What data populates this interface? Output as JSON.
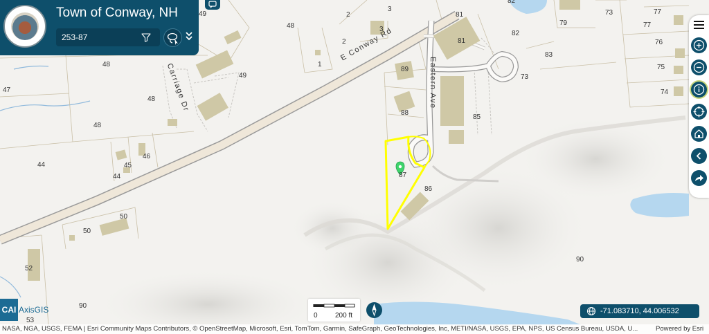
{
  "header": {
    "title": "Town of Conway, NH",
    "search": {
      "value": "253-87",
      "placeholder": ""
    },
    "logo_text": "TOWN OF CONWAY"
  },
  "toolbar": {
    "items": [
      "menu",
      "zoom-in",
      "zoom-out",
      "identify",
      "locate",
      "home",
      "collapse",
      "share"
    ]
  },
  "roads": {
    "e_conway": "E Conway Rd",
    "eastern_ave": "Eastern Ave",
    "carriage_dr": "Carriage Dr"
  },
  "parcel_labels": {
    "p49a": "49",
    "p2a": "2",
    "p3a": "3",
    "p3b": "3",
    "p48a": "48",
    "p2b": "2",
    "p1": "1",
    "p48b": "48",
    "p49b": "49",
    "p47": "47",
    "p48c": "48",
    "p48d": "48",
    "p44a": "44",
    "p45": "45",
    "p46": "46",
    "p44b": "44",
    "p50a": "50",
    "p50b": "50",
    "p52": "52",
    "p90a": "90",
    "p53": "53",
    "p89": "89",
    "p88": "88",
    "p87": "87",
    "p86": "86",
    "p85": "85",
    "p81a": "81",
    "p81b": "81",
    "p82a": "82",
    "p82b": "82",
    "p83": "83",
    "p73a": "73",
    "p73b": "73",
    "p79": "79",
    "p77a": "77",
    "p77b": "77",
    "p76": "76",
    "p75": "75",
    "p74": "74",
    "p90b": "90"
  },
  "scale": {
    "zero": "0",
    "distance": "200 ft"
  },
  "coordinates": "-71.083710, 44.006532",
  "brand": {
    "cai": "CAI",
    "axisgis": "AxisGIS"
  },
  "attribution": "NASA, NGA, USGS, FEMA | Esri Community Maps Contributors, © OpenStreetMap, Microsoft, Esri, TomTom, Garmin, SafeGraph, GeoTechnologies, Inc, METI/NASA, USGS, EPA, NPS, US Census Bureau, USDA, U...",
  "powered_by": "Powered by Esri",
  "colors": {
    "header": "#0e4f6b",
    "highlight": "#ffff00",
    "pin": "#3fd46b",
    "building": "#d0c9a8",
    "water": "#aed4ef"
  }
}
